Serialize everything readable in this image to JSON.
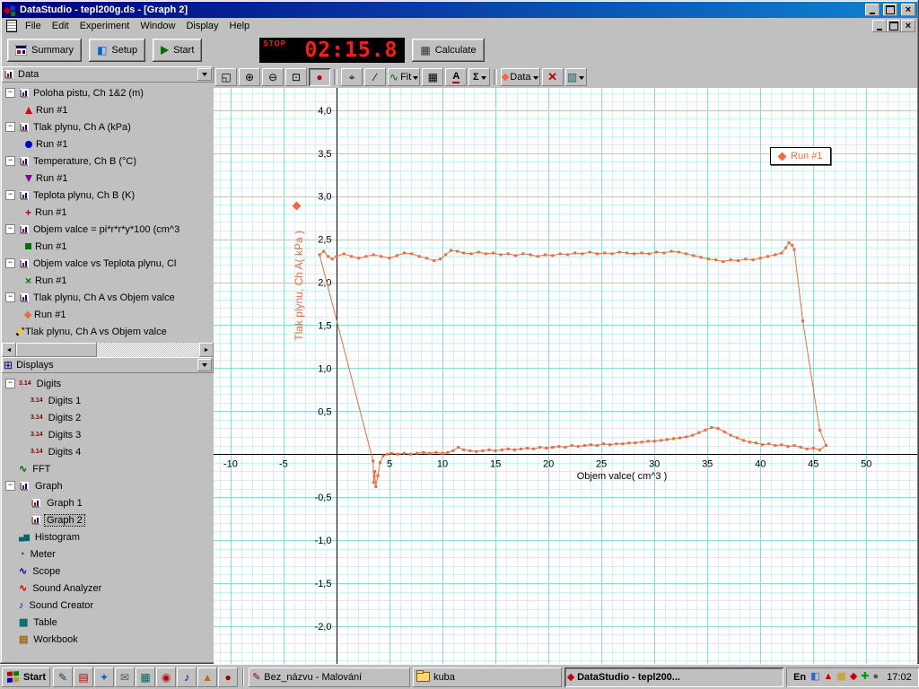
{
  "titlebar": {
    "title": "DataStudio - tepl200g.ds - [Graph 2]"
  },
  "menubar": {
    "items": [
      "File",
      "Edit",
      "Experiment",
      "Window",
      "Display",
      "Help"
    ]
  },
  "toolbar": {
    "summary": "Summary",
    "setup": "Setup",
    "start": "Start",
    "timer": {
      "stop": "STOP",
      "time": "02:15.8"
    },
    "calculate": "Calculate"
  },
  "graph_toolbar": {
    "fit": "Fit",
    "text_tool": "A",
    "sigma": "Σ",
    "data": "Data"
  },
  "data_panel": {
    "title": "Data",
    "items": [
      {
        "type": "parent",
        "label": "Poloha pistu, Ch 1&2 (m)"
      },
      {
        "type": "run",
        "label": "Run #1",
        "marker": "triangle-up",
        "color": "#e00000"
      },
      {
        "type": "parent",
        "label": "Tlak plynu, Ch A (kPa)"
      },
      {
        "type": "run",
        "label": "Run #1",
        "marker": "circle",
        "color": "#0000d0"
      },
      {
        "type": "parent",
        "label": "Temperature, Ch B (°C)"
      },
      {
        "type": "run",
        "label": "Run #1",
        "marker": "triangle-down",
        "color": "#8000a0"
      },
      {
        "type": "parent",
        "label": "Teplota plynu, Ch B (K)"
      },
      {
        "type": "run",
        "label": "Run #1",
        "marker": "plus",
        "color": "#c00000"
      },
      {
        "type": "parent",
        "label": "Objem valce = pi*r*r*y*100 (cm^3"
      },
      {
        "type": "run",
        "label": "Run #1",
        "marker": "square",
        "color": "#007000"
      },
      {
        "type": "parent",
        "label": "Objem valce vs Teplota plynu, Cl"
      },
      {
        "type": "run",
        "label": "Run #1",
        "marker": "x",
        "color": "#007000"
      },
      {
        "type": "parent",
        "label": "Tlak plynu, Ch A vs Objem valce"
      },
      {
        "type": "run",
        "label": "Run #1",
        "marker": "diamond",
        "color": "#f26a3c"
      },
      {
        "type": "leaf",
        "label": "Tlak plynu, Ch A vs Objem valce",
        "icon": "pen"
      }
    ]
  },
  "displays_panel": {
    "title": "Displays",
    "items": [
      {
        "label": "Digits",
        "level": 0,
        "icon": "digits",
        "expand": true
      },
      {
        "label": "Digits 1",
        "level": 1,
        "icon": "digits"
      },
      {
        "label": "Digits 2",
        "level": 1,
        "icon": "digits"
      },
      {
        "label": "Digits 3",
        "level": 1,
        "icon": "digits"
      },
      {
        "label": "Digits 4",
        "level": 1,
        "icon": "digits"
      },
      {
        "label": "FFT",
        "level": 0,
        "icon": "fft"
      },
      {
        "label": "Graph",
        "level": 0,
        "icon": "graph",
        "expand": true
      },
      {
        "label": "Graph 1",
        "level": 1,
        "icon": "graph"
      },
      {
        "label": "Graph 2",
        "level": 1,
        "icon": "graph",
        "selected": true
      },
      {
        "label": "Histogram",
        "level": 0,
        "icon": "hist"
      },
      {
        "label": "Meter",
        "level": 0,
        "icon": "meter"
      },
      {
        "label": "Scope",
        "level": 0,
        "icon": "scope"
      },
      {
        "label": "Sound Analyzer",
        "level": 0,
        "icon": "sounda"
      },
      {
        "label": "Sound Creator",
        "level": 0,
        "icon": "soundc"
      },
      {
        "label": "Table",
        "level": 0,
        "icon": "table"
      },
      {
        "label": "Workbook",
        "level": 0,
        "icon": "book"
      }
    ]
  },
  "chart_data": {
    "type": "scatter",
    "title": "",
    "xlabel": "Objem valce( cm^3 )",
    "ylabel": "Tlak plynu, Ch A( kPa )",
    "xlim": [
      -11.6,
      54.8
    ],
    "ylim": [
      -2.44,
      4.26
    ],
    "x_minor": 1,
    "x_major": 5,
    "y_minor": 0.1,
    "y_major": 0.5,
    "grid": {
      "minor_color": "#cdf4f4",
      "major_color": "#7fe0e0",
      "background": "#ffffff"
    },
    "x_ticks": [
      {
        "v": -10,
        "l": "-10"
      },
      {
        "v": -5,
        "l": "-5"
      },
      {
        "v": 5,
        "l": "5"
      },
      {
        "v": 10,
        "l": "10"
      },
      {
        "v": 15,
        "l": "15"
      },
      {
        "v": 20,
        "l": "20"
      },
      {
        "v": 25,
        "l": "25"
      },
      {
        "v": 30,
        "l": "30"
      },
      {
        "v": 35,
        "l": "35"
      },
      {
        "v": 40,
        "l": "40"
      },
      {
        "v": 45,
        "l": "45"
      },
      {
        "v": 50,
        "l": "50"
      }
    ],
    "y_ticks": [
      {
        "v": 4,
        "l": "4,0"
      },
      {
        "v": 3.5,
        "l": "3,5"
      },
      {
        "v": 3,
        "l": "3,0"
      },
      {
        "v": 2.5,
        "l": "2,5"
      },
      {
        "v": 2,
        "l": "2,0"
      },
      {
        "v": 1.5,
        "l": "1,5"
      },
      {
        "v": 1,
        "l": "1,0"
      },
      {
        "v": 0.5,
        "l": "0,5"
      },
      {
        "v": -0.5,
        "l": "-0,5"
      },
      {
        "v": -1,
        "l": "-1,0"
      },
      {
        "v": -1.5,
        "l": "-1,5"
      },
      {
        "v": -2,
        "l": "-2,0"
      }
    ],
    "legend": {
      "label": "Run #1",
      "position": "top-right"
    },
    "series": [
      {
        "name": "Run #1",
        "color": "#f26a3c",
        "points": [
          [
            -1.6,
            2.32
          ],
          [
            -1.2,
            2.36
          ],
          [
            -0.8,
            2.3
          ],
          [
            -0.4,
            2.27
          ],
          [
            0,
            2.3
          ],
          [
            0.7,
            2.33
          ],
          [
            1.4,
            2.3
          ],
          [
            2.1,
            2.28
          ],
          [
            2.8,
            2.3
          ],
          [
            3.5,
            2.32
          ],
          [
            4.2,
            2.3
          ],
          [
            5,
            2.28
          ],
          [
            5.7,
            2.31
          ],
          [
            6.4,
            2.34
          ],
          [
            7.1,
            2.33
          ],
          [
            7.8,
            2.3
          ],
          [
            8.5,
            2.28
          ],
          [
            9.2,
            2.25
          ],
          [
            9.8,
            2.27
          ],
          [
            10.3,
            2.32
          ],
          [
            10.8,
            2.37
          ],
          [
            11.4,
            2.36
          ],
          [
            12,
            2.34
          ],
          [
            12.7,
            2.33
          ],
          [
            13.4,
            2.35
          ],
          [
            14.1,
            2.33
          ],
          [
            14.8,
            2.34
          ],
          [
            15.5,
            2.32
          ],
          [
            16.2,
            2.33
          ],
          [
            16.9,
            2.31
          ],
          [
            17.6,
            2.33
          ],
          [
            18.3,
            2.32
          ],
          [
            19,
            2.3
          ],
          [
            19.7,
            2.32
          ],
          [
            20.4,
            2.31
          ],
          [
            21.1,
            2.33
          ],
          [
            21.8,
            2.32
          ],
          [
            22.5,
            2.34
          ],
          [
            23.2,
            2.33
          ],
          [
            23.9,
            2.35
          ],
          [
            24.6,
            2.33
          ],
          [
            25.3,
            2.34
          ],
          [
            26,
            2.33
          ],
          [
            26.7,
            2.35
          ],
          [
            27.4,
            2.34
          ],
          [
            28.1,
            2.33
          ],
          [
            28.8,
            2.34
          ],
          [
            29.5,
            2.33
          ],
          [
            30.2,
            2.35
          ],
          [
            30.9,
            2.34
          ],
          [
            31.6,
            2.36
          ],
          [
            32.3,
            2.35
          ],
          [
            33,
            2.33
          ],
          [
            33.7,
            2.31
          ],
          [
            34.4,
            2.29
          ],
          [
            35.1,
            2.27
          ],
          [
            35.8,
            2.26
          ],
          [
            36.5,
            2.24
          ],
          [
            37.2,
            2.26
          ],
          [
            37.9,
            2.25
          ],
          [
            38.6,
            2.27
          ],
          [
            39.3,
            2.26
          ],
          [
            40,
            2.28
          ],
          [
            40.7,
            2.3
          ],
          [
            41.4,
            2.32
          ],
          [
            42,
            2.34
          ],
          [
            42.4,
            2.4
          ],
          [
            42.7,
            2.46
          ],
          [
            43,
            2.43
          ],
          [
            43.2,
            2.38
          ],
          [
            44,
            1.55
          ],
          [
            45.6,
            0.28
          ],
          [
            46.2,
            0.1
          ],
          [
            45.6,
            0.05
          ],
          [
            45,
            0.07
          ],
          [
            44.4,
            0.06
          ],
          [
            43.8,
            0.08
          ],
          [
            43.2,
            0.1
          ],
          [
            42.6,
            0.09
          ],
          [
            42,
            0.11
          ],
          [
            41.4,
            0.1
          ],
          [
            40.8,
            0.12
          ],
          [
            40.2,
            0.11
          ],
          [
            39.6,
            0.13
          ],
          [
            39,
            0.14
          ],
          [
            38.4,
            0.16
          ],
          [
            37.8,
            0.19
          ],
          [
            37.2,
            0.22
          ],
          [
            36.6,
            0.26
          ],
          [
            36,
            0.3
          ],
          [
            35.4,
            0.31
          ],
          [
            34.8,
            0.28
          ],
          [
            34.2,
            0.25
          ],
          [
            33.6,
            0.22
          ],
          [
            33,
            0.2
          ],
          [
            32.4,
            0.19
          ],
          [
            31.8,
            0.18
          ],
          [
            31.2,
            0.17
          ],
          [
            30.6,
            0.16
          ],
          [
            30,
            0.15
          ],
          [
            29.4,
            0.15
          ],
          [
            28.8,
            0.14
          ],
          [
            28.2,
            0.13
          ],
          [
            27.6,
            0.13
          ],
          [
            27,
            0.12
          ],
          [
            26.4,
            0.12
          ],
          [
            25.8,
            0.11
          ],
          [
            25.2,
            0.12
          ],
          [
            24.6,
            0.1
          ],
          [
            24,
            0.11
          ],
          [
            23.4,
            0.1
          ],
          [
            22.8,
            0.09
          ],
          [
            22.2,
            0.1
          ],
          [
            21.6,
            0.08
          ],
          [
            21,
            0.09
          ],
          [
            20.4,
            0.08
          ],
          [
            19.8,
            0.07
          ],
          [
            19.2,
            0.08
          ],
          [
            18.6,
            0.06
          ],
          [
            18,
            0.07
          ],
          [
            17.4,
            0.06
          ],
          [
            16.8,
            0.05
          ],
          [
            16.2,
            0.06
          ],
          [
            15.6,
            0.05
          ],
          [
            15,
            0.04
          ],
          [
            14.4,
            0.05
          ],
          [
            13.8,
            0.04
          ],
          [
            13.2,
            0.03
          ],
          [
            12.6,
            0.04
          ],
          [
            12,
            0.05
          ],
          [
            11.5,
            0.08
          ],
          [
            11,
            0.04
          ],
          [
            10.5,
            0.02
          ],
          [
            10,
            0.01
          ],
          [
            9.4,
            0.02
          ],
          [
            8.8,
            0.01
          ],
          [
            8.2,
            0.02
          ],
          [
            7.6,
            0.01
          ],
          [
            7,
            0
          ],
          [
            6.4,
            0.01
          ],
          [
            5.8,
            0
          ],
          [
            5.2,
            0.01
          ],
          [
            4.8,
            0
          ],
          [
            4.4,
            -0.02
          ],
          [
            4.1,
            -0.1
          ],
          [
            3.9,
            -0.25
          ],
          [
            3.7,
            -0.38
          ],
          [
            3.6,
            -0.2
          ],
          [
            3.5,
            -0.33
          ],
          [
            3.45,
            -0.08
          ],
          [
            -1.6,
            2.32
          ]
        ]
      }
    ]
  },
  "taskbar": {
    "start": "Start",
    "quick_launch": [
      {
        "name": "edit-shortcut-icon",
        "glyph": "✎",
        "color": "#333366"
      },
      {
        "name": "document-shortcut-icon",
        "glyph": "▤",
        "color": "#c00000"
      },
      {
        "name": "app-shortcut-icon-1",
        "glyph": "✦",
        "color": "#0066cc"
      },
      {
        "name": "mail-shortcut-icon",
        "glyph": "✉",
        "color": "#555555"
      },
      {
        "name": "app-shortcut-icon-2",
        "glyph": "▦",
        "color": "#006666"
      },
      {
        "name": "app-shortcut-icon-3",
        "glyph": "◉",
        "color": "#c00000"
      },
      {
        "name": "media-shortcut-icon",
        "glyph": "♪",
        "color": "#000080"
      },
      {
        "name": "app-shortcut-icon-4",
        "glyph": "▲",
        "color": "#cc6600"
      },
      {
        "name": "app-shortcut-icon-5",
        "glyph": "●",
        "color": "#990000"
      }
    ],
    "tasks": [
      {
        "label": "Bez_názvu - Malování",
        "icon": "paint",
        "active": false
      },
      {
        "label": "kuba",
        "icon": "folder",
        "active": false
      },
      {
        "label": "DataStudio - tepl200...",
        "icon": "datastudio",
        "active": true
      }
    ],
    "tray": {
      "lang": "En",
      "icons": [
        {
          "name": "tray-icon-1",
          "glyph": "◧",
          "color": "#3366cc"
        },
        {
          "name": "tray-icon-2",
          "glyph": "▲",
          "color": "#cc0000"
        },
        {
          "name": "tray-icon-3",
          "glyph": "▦",
          "color": "#cc9900"
        },
        {
          "name": "tray-icon-4",
          "glyph": "◆",
          "color": "#cc0000"
        },
        {
          "name": "tray-icon-5",
          "glyph": "✚",
          "color": "#009900"
        },
        {
          "name": "tray-icon-6",
          "glyph": "●",
          "color": "#555555"
        }
      ],
      "clock": "17:02"
    }
  }
}
